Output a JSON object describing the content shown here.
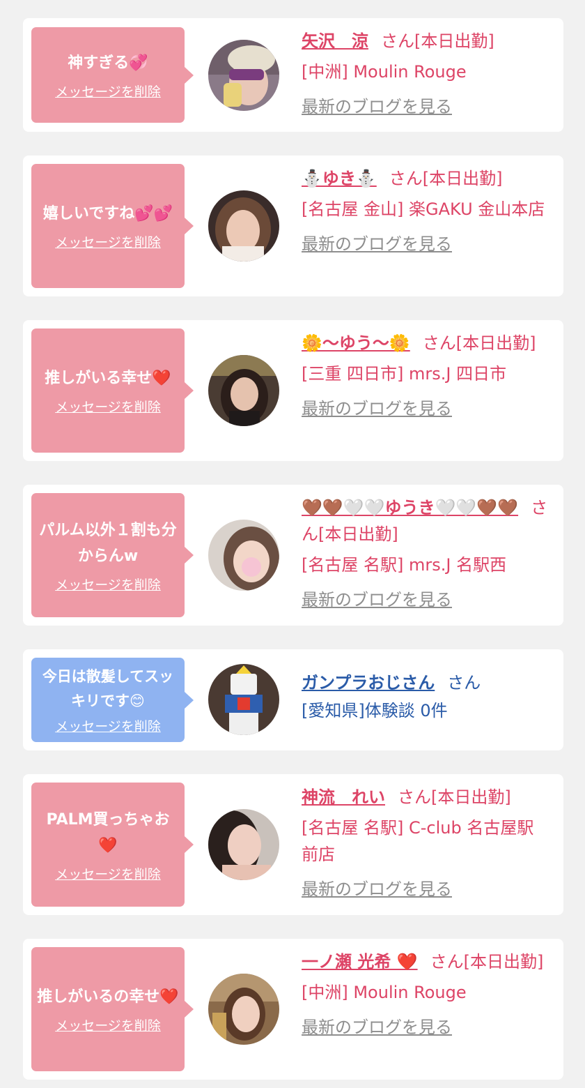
{
  "common": {
    "delete_label": "メッセージを削除",
    "blog_label": "最新のブログを見る"
  },
  "cards": [
    {
      "message": "神すぎる💞",
      "name": "矢沢　涼",
      "suffix": "さん[本日出勤]",
      "shop": "[中洲] Moulin Rouge",
      "has_blog": true,
      "theme": "pink"
    },
    {
      "message": "嬉しいですね💕💕",
      "name": "⛄ゆき⛄",
      "suffix": "さん[本日出勤]",
      "shop": "[名古屋 金山] 楽GAKU 金山本店",
      "has_blog": true,
      "theme": "pink"
    },
    {
      "message": "推しがいる幸せ❤️",
      "name": "🌼〜ゆう〜🌼",
      "suffix": "さん[本日出勤]",
      "shop": "[三重 四日市] mrs.J 四日市",
      "has_blog": true,
      "theme": "pink"
    },
    {
      "message": "パルム以外１割も分からんw",
      "name": "🤎🤎🤍🤍ゆうき🤍🤍🤎🤎",
      "suffix": "さん[本日出勤]",
      "shop": "[名古屋 名駅] mrs.J 名駅西",
      "has_blog": true,
      "theme": "pink"
    },
    {
      "message": "今日は散髪してスッキリです😊",
      "name": "ガンプラおじさん",
      "suffix": "さん",
      "shop": "[愛知県]体験談 0件",
      "has_blog": false,
      "theme": "blue"
    },
    {
      "message": "PALM買っちゃお❤️",
      "name": "神流　れい",
      "suffix": "さん[本日出勤]",
      "shop": "[名古屋 名駅] C-club 名古屋駅前店",
      "has_blog": true,
      "theme": "pink"
    },
    {
      "message": "推しがいるの幸せ❤️",
      "name": "一ノ瀬 光希 ❤️",
      "suffix": "さん[本日出勤]",
      "shop": "[中洲] Moulin Rouge",
      "has_blog": true,
      "theme": "pink"
    }
  ]
}
